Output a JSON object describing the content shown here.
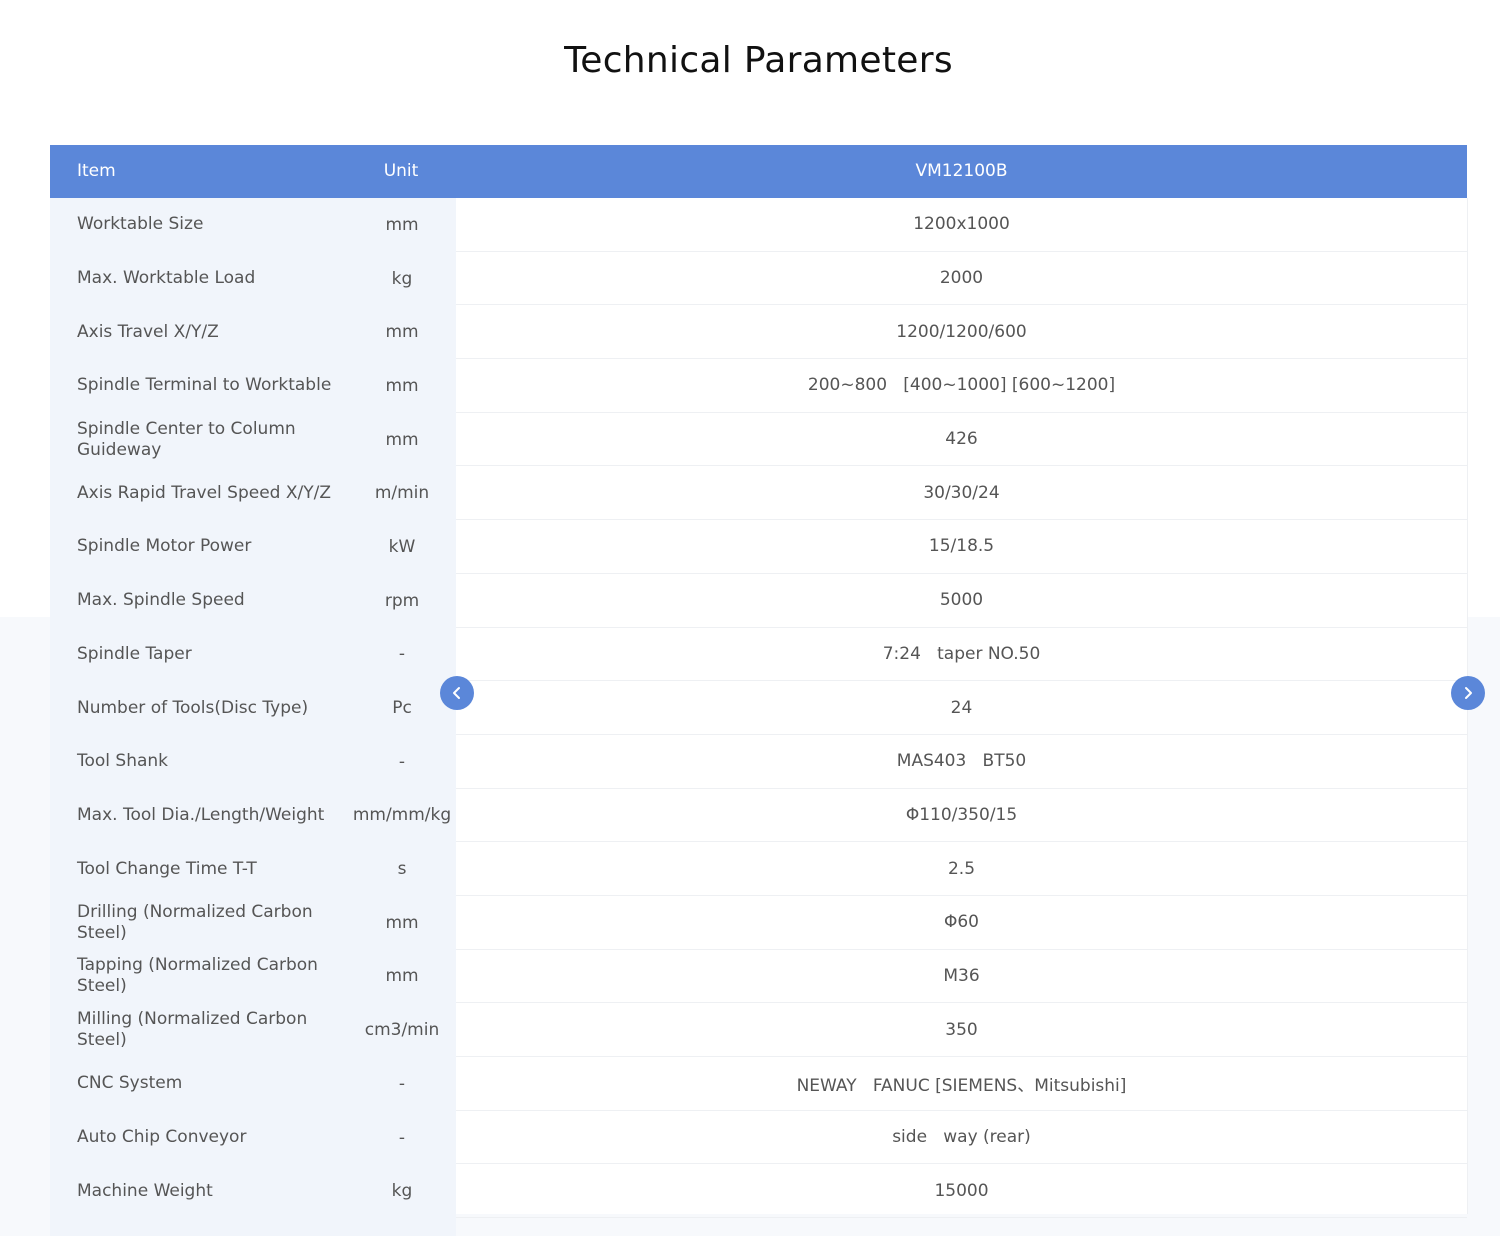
{
  "page": {
    "title": "Technical Parameters"
  },
  "table": {
    "headers": {
      "item": "Item",
      "unit": "Unit",
      "model": "VM12100B"
    },
    "rows": [
      {
        "item": "Worktable   Size",
        "unit": "mm",
        "value": "1200x1000"
      },
      {
        "item": "Max. Worktable Load",
        "unit": "kg",
        "value": "2000"
      },
      {
        "item": "Axis Travel X/Y/Z",
        "unit": "mm",
        "value": "1200/1200/600"
      },
      {
        "item": "Spindle Terminal to Worktable",
        "unit": "mm",
        "value": "200~800   [400~1000] [600~1200]"
      },
      {
        "item": "Spindle Center to Column Guideway",
        "unit": "mm",
        "value": "426"
      },
      {
        "item": "Axis Rapid Travel Speed X/Y/Z",
        "unit": "m/min",
        "value": "30/30/24"
      },
      {
        "item": "Spindle Motor Power",
        "unit": "kW",
        "value": "15/18.5"
      },
      {
        "item": "Max. Spindle Speed",
        "unit": "rpm",
        "value": "5000"
      },
      {
        "item": "Spindle Taper",
        "unit": "-",
        "value": "7:24   taper NO.50"
      },
      {
        "item": "Number of Tools(Disc Type)",
        "unit": "Pc",
        "value": "24"
      },
      {
        "item": "Tool Shank",
        "unit": "-",
        "value": "MAS403   BT50"
      },
      {
        "item": "Max. Tool Dia./Length/Weight",
        "unit": "mm/mm/kg",
        "value": "Φ110/350/15"
      },
      {
        "item": "Tool Change Time T-T",
        "unit": "s",
        "value": "2.5"
      },
      {
        "item": "Drilling (Normalized    Carbon Steel)",
        "unit": "mm",
        "value": "Φ60"
      },
      {
        "item": "Tapping (Normalized  Carbon Steel)",
        "unit": "mm",
        "value": "M36"
      },
      {
        "item": "Milling (Normalized  Carbon Steel)",
        "unit": "cm3/min",
        "value": "350"
      },
      {
        "item": "CNC System",
        "unit": "-",
        "value": "NEWAY   FANUC [SIEMENS、Mitsubishi]"
      },
      {
        "item": "Auto Chip Conveyor",
        "unit": "-",
        "value": "side   way (rear)"
      },
      {
        "item": "Machine Weight",
        "unit": "kg",
        "value": "15000"
      }
    ]
  },
  "navigation": {
    "prev_icon": "chevron-left-icon",
    "next_icon": "chevron-right-icon",
    "color": "#5b87d9"
  },
  "colors": {
    "header_bg": "#5b87d9",
    "label_column_bg": "#f1f5fb",
    "title_color": "#111111"
  }
}
